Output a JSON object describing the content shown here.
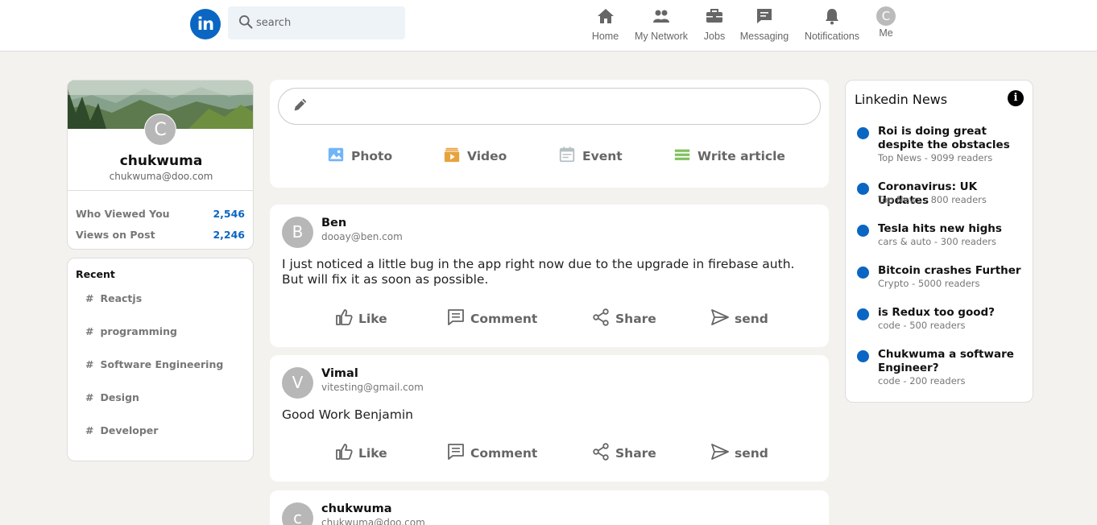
{
  "header": {
    "logo": "in",
    "search_placeholder": "search",
    "nav": [
      {
        "label": "Home",
        "icon": "home-icon"
      },
      {
        "label": "My Network",
        "icon": "network-icon"
      },
      {
        "label": "Jobs",
        "icon": "briefcase-icon"
      },
      {
        "label": "Messaging",
        "icon": "message-icon"
      },
      {
        "label": "Notifications",
        "icon": "bell-icon"
      },
      {
        "label": "Me",
        "icon": "avatar",
        "initial": "C"
      }
    ]
  },
  "sidebar": {
    "avatar_initial": "C",
    "name": "chukwuma",
    "email": "chukwuma@doo.com",
    "stats": [
      {
        "label": "Who Viewed You",
        "value": "2,546"
      },
      {
        "label": "Views on Post",
        "value": "2,246"
      }
    ],
    "recent_title": "Recent",
    "recent": [
      "Reactjs",
      "programming",
      "Software Engineering",
      "Design",
      "Developer"
    ]
  },
  "compose": {
    "options": [
      {
        "label": "Photo",
        "color": "#70b5f9"
      },
      {
        "label": "Video",
        "color": "#e7a33e"
      },
      {
        "label": "Event",
        "color": "#c0cbcd"
      },
      {
        "label": "Write article",
        "color": "#7fc15e"
      }
    ]
  },
  "posts": [
    {
      "initial": "B",
      "name": "Ben",
      "email": "dooay@ben.com",
      "text": "I just noticed a little bug in the app right now due to the upgrade in firebase auth. But will fix it as soon as possible."
    },
    {
      "initial": "V",
      "name": "Vimal",
      "email": "vitesting@gmail.com",
      "text": "Good Work Benjamin"
    },
    {
      "initial": "c",
      "name": "chukwuma",
      "email": "chukwuma@doo.com",
      "text": ""
    }
  ],
  "post_actions": [
    "Like",
    "Comment",
    "Share",
    "send"
  ],
  "news": {
    "title": "Linkedin News",
    "info": "i",
    "items": [
      {
        "headline": "Roi is doing great despite the obstacles",
        "sub": "Top News - 9099 readers"
      },
      {
        "headline": "Coronavirus: UK Updates",
        "sub": "Top News - 800 readers"
      },
      {
        "headline": "Tesla hits new highs",
        "sub": "cars & auto - 300 readers"
      },
      {
        "headline": "Bitcoin crashes Further",
        "sub": "Crypto - 5000 readers"
      },
      {
        "headline": "is Redux too good?",
        "sub": "code - 500 readers"
      },
      {
        "headline": "Chukwuma a software Engineer?",
        "sub": "code - 200 readers"
      }
    ]
  }
}
